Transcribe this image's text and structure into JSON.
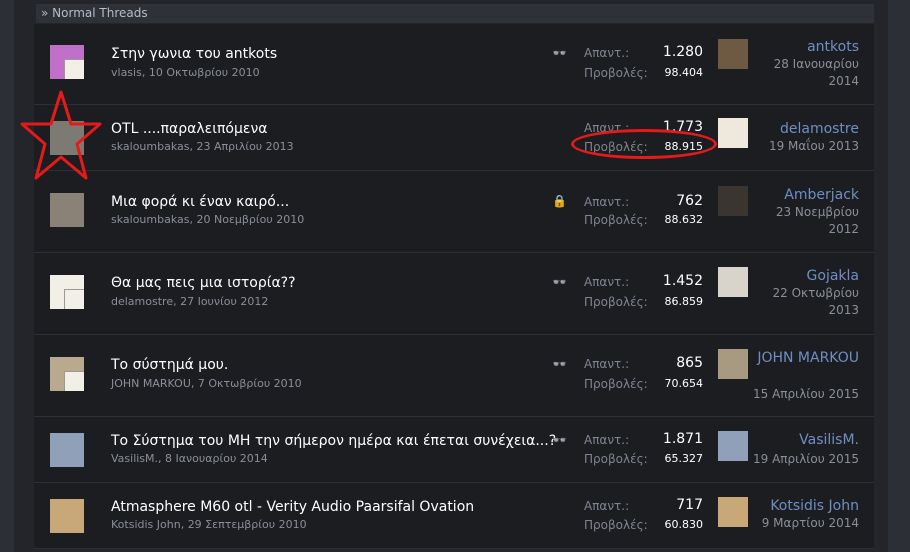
{
  "section": {
    "title": "» Normal Threads"
  },
  "labels": {
    "replies": "Απαντ.:",
    "views": "Προβολές:"
  },
  "threads": [
    {
      "title": "Στην γωνια του antkots",
      "author": "vlasis",
      "date": "10 Οκτωβρίου 2010",
      "icon": "binoculars-icon",
      "replies": "1.280",
      "views": "98.404",
      "last_poster": "antkots",
      "last_date": "28 Ιανουαρίου 2014"
    },
    {
      "title": "OTL ....παραλειπόμενα",
      "author": "skaloumbakas",
      "date": "23 Απριλίου 2013",
      "icon": "",
      "replies": "1.773",
      "views": "88.915",
      "last_poster": "delamostre",
      "last_date": "19 Μαΐου 2013"
    },
    {
      "title": "Μια φορά κι έναν καιρό...",
      "author": "skaloumbakas",
      "date": "20 Νοεμβρίου 2010",
      "icon": "lock-icon",
      "replies": "762",
      "views": "88.632",
      "last_poster": "Amberjack",
      "last_date": "23 Νοεμβρίου 2012"
    },
    {
      "title": "Θα μας πεις μια ιστορία??",
      "author": "delamostre",
      "date": "27 Ιουνίου 2012",
      "icon": "binoculars-icon",
      "replies": "1.452",
      "views": "86.859",
      "last_poster": "Gojakla",
      "last_date": "22 Οκτωβρίου 2013"
    },
    {
      "title": "Το σύστημά μου.",
      "author": "JOHN MARKOU",
      "date": "7 Οκτωβρίου 2010",
      "icon": "binoculars-icon",
      "replies": "865",
      "views": "70.654",
      "last_poster": "JOHN MARKOU",
      "last_date": "15 Απριλίου 2015"
    },
    {
      "title": "Το Σύστημα του ΜΗ την σήμερον ημέρα και έπεται συνέχεια...?",
      "author": "VasilisM.",
      "date": "8 Ιανουαρίου 2014",
      "icon": "binoculars-icon",
      "replies": "1.871",
      "views": "65.327",
      "last_poster": "VasilisM.",
      "last_date": "19 Απριλίου 2015"
    },
    {
      "title": "Atmasphere M60 otl - Verity Audio Paarsifal Ovation",
      "author": "Kotsidis John",
      "date": "29 Σεπτεμβρίου 2010",
      "icon": "",
      "replies": "717",
      "views": "60.830",
      "last_poster": "Kotsidis John",
      "last_date": "9 Μαρτίου 2014"
    }
  ]
}
